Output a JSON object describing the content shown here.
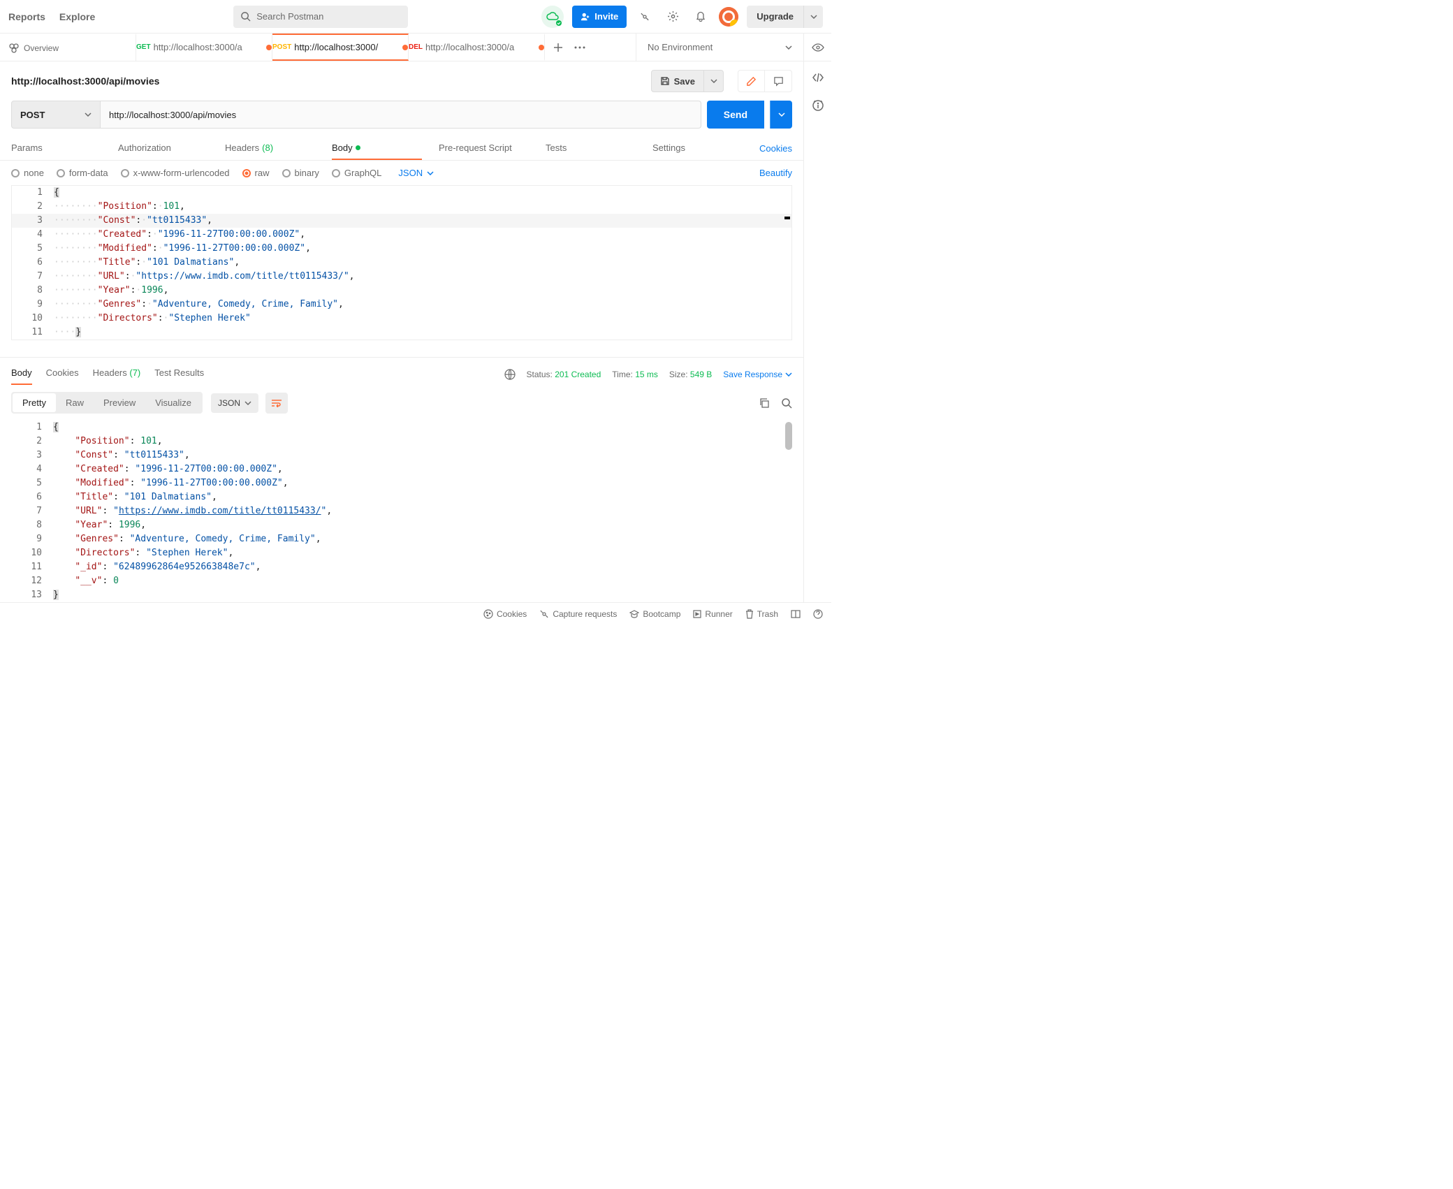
{
  "topNav": {
    "reports": "Reports",
    "explore": "Explore"
  },
  "search": {
    "placeholder": "Search Postman"
  },
  "invite": "Invite",
  "upgrade": "Upgrade",
  "tabs": {
    "overview": "Overview",
    "t1": {
      "method": "GET",
      "label": "http://localhost:3000/a"
    },
    "t2": {
      "method": "POST",
      "label": "http://localhost:3000/"
    },
    "t3": {
      "method": "DEL",
      "label": "http://localhost:3000/a"
    }
  },
  "environment": "No Environment",
  "request": {
    "title": "http://localhost:3000/api/movies",
    "save": "Save",
    "method": "POST",
    "url": "http://localhost:3000/api/movies",
    "send": "Send"
  },
  "reqTabs": {
    "params": "Params",
    "authorization": "Authorization",
    "headers": "Headers",
    "headersCount": "(8)",
    "body": "Body",
    "prerequest": "Pre-request Script",
    "tests": "Tests",
    "settings": "Settings",
    "cookies": "Cookies"
  },
  "bodyTypes": {
    "none": "none",
    "formdata": "form-data",
    "xwww": "x-www-form-urlencoded",
    "raw": "raw",
    "binary": "binary",
    "graphql": "GraphQL",
    "format": "JSON",
    "beautify": "Beautify"
  },
  "reqBody": {
    "Position": 101,
    "Const": "tt0115433",
    "Created": "1996-11-27T00:00:00.000Z",
    "Modified": "1996-11-27T00:00:00.000Z",
    "Title": "101 Dalmatians",
    "URL": "https://www.imdb.com/title/tt0115433/",
    "Year": 1996,
    "Genres": "Adventure, Comedy, Crime, Family",
    "Directors": "Stephen Herek"
  },
  "respTabs": {
    "body": "Body",
    "cookies": "Cookies",
    "headers": "Headers",
    "headersCount": "(7)",
    "testResults": "Test Results"
  },
  "respMeta": {
    "statusLabel": "Status:",
    "statusVal": "201 Created",
    "timeLabel": "Time:",
    "timeVal": "15 ms",
    "sizeLabel": "Size:",
    "sizeVal": "549 B",
    "saveResponse": "Save Response"
  },
  "respViews": {
    "pretty": "Pretty",
    "raw": "Raw",
    "preview": "Preview",
    "visualize": "Visualize",
    "format": "JSON"
  },
  "respBody": {
    "Position": 101,
    "Const": "tt0115433",
    "Created": "1996-11-27T00:00:00.000Z",
    "Modified": "1996-11-27T00:00:00.000Z",
    "Title": "101 Dalmatians",
    "URL": "https://www.imdb.com/title/tt0115433/",
    "Year": 1996,
    "Genres": "Adventure, Comedy, Crime, Family",
    "Directors": "Stephen Herek",
    "_id": "62489962864e952663848e7c",
    "__v": 0
  },
  "footer": {
    "cookies": "Cookies",
    "capture": "Capture requests",
    "bootcamp": "Bootcamp",
    "runner": "Runner",
    "trash": "Trash"
  }
}
